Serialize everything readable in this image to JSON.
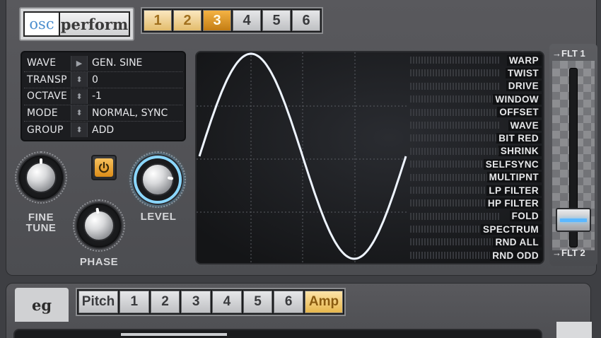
{
  "mode_tabs": [
    {
      "label": "osc",
      "selected": true
    },
    {
      "label": "perform",
      "selected": false
    }
  ],
  "osc_selector": {
    "buttons": [
      "1",
      "2",
      "3",
      "4",
      "5",
      "6"
    ],
    "active": "3"
  },
  "params": [
    {
      "label": "WAVE",
      "value": "GEN. SINE",
      "control": "arrow"
    },
    {
      "label": "TRANSP",
      "value": "0",
      "control": "stepper"
    },
    {
      "label": "OCTAVE",
      "value": "-1",
      "control": "stepper"
    },
    {
      "label": "MODE",
      "value": "NORMAL, SYNC",
      "control": "stepper"
    },
    {
      "label": "GROUP",
      "value": "ADD",
      "control": "stepper"
    }
  ],
  "knobs": {
    "fine_tune": {
      "label_line1": "FINE",
      "label_line2": "TUNE"
    },
    "phase": {
      "label": "PHASE"
    },
    "level": {
      "label": "LEVEL"
    }
  },
  "modifiers": [
    "WARP",
    "TWIST",
    "DRIVE",
    "WINDOW",
    "OFFSET",
    "WAVE",
    "BIT RED",
    "SHRINK",
    "SELFSYNC",
    "MULTIPNT",
    "LP FILTER",
    "HP FILTER",
    "FOLD",
    "SPECTRUM",
    "RND ALL",
    "RND ODD"
  ],
  "filter_routing": {
    "top_label": "FLT 1",
    "bottom_label": "FLT 2",
    "arrow": "→",
    "value": 0.92
  },
  "eg": {
    "tab_label": "eg",
    "buttons": [
      "Pitch",
      "1",
      "2",
      "3",
      "4",
      "5",
      "6",
      "Amp"
    ],
    "active": "Amp"
  },
  "colors": {
    "accent_gold": "#e3a23a",
    "glow_blue": "#5cc6ff",
    "panel": "#525357"
  }
}
